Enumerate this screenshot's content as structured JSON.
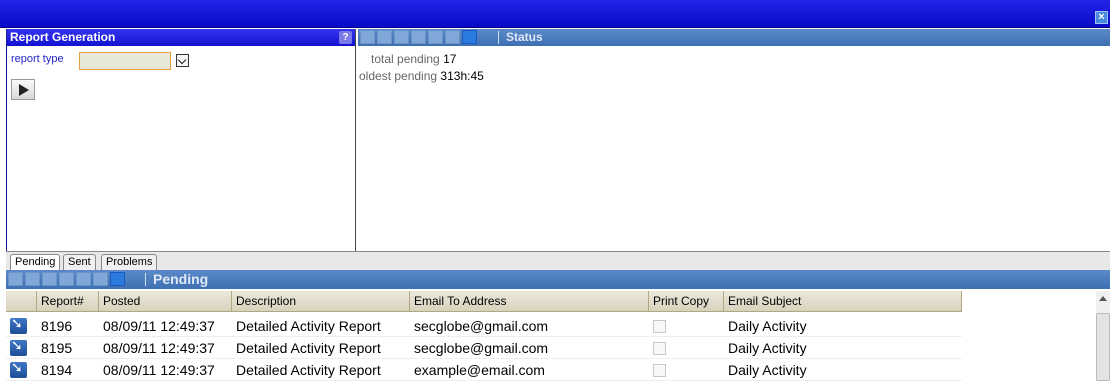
{
  "window": {
    "close_glyph": "×"
  },
  "report_generation": {
    "title": "Report Generation",
    "help_glyph": "?",
    "report_type_label": "report type",
    "report_type_value": ""
  },
  "status": {
    "title": "Status",
    "total_pending_label": "total pending",
    "total_pending_value": "17",
    "oldest_pending_label": "oldest pending",
    "oldest_pending_value": "313h:45"
  },
  "tabs": [
    {
      "label": "Pending",
      "active": true
    },
    {
      "label": "Sent",
      "active": false
    },
    {
      "label": "Problems",
      "active": false
    }
  ],
  "pending": {
    "title": "Pending",
    "columns": [
      "Report#",
      "Posted",
      "Description",
      "Email To Address",
      "Print Copy",
      "Email Subject"
    ],
    "rows": [
      {
        "report": "8196",
        "posted": "08/09/11 12:49:37",
        "description": "Detailed Activity Report",
        "email": "secglobe@gmail.com",
        "print_copy": false,
        "subject": "Daily Activity"
      },
      {
        "report": "8195",
        "posted": "08/09/11 12:49:37",
        "description": "Detailed Activity Report",
        "email": "secglobe@gmail.com",
        "print_copy": false,
        "subject": "Daily Activity"
      },
      {
        "report": "8194",
        "posted": "08/09/11 12:49:37",
        "description": "Detailed Activity Report",
        "email": "example@email.com",
        "print_copy": false,
        "subject": "Daily Activity"
      }
    ]
  },
  "colors": {
    "title_bar": "#1414d8",
    "panel_header": "#4a7cbe",
    "table_header": "#e2ddc8"
  },
  "icons": [
    "close-icon",
    "help-icon",
    "dropdown-icon",
    "play-icon",
    "row-arrow-icon",
    "toolbar-icons",
    "scroll-up-icon"
  ]
}
